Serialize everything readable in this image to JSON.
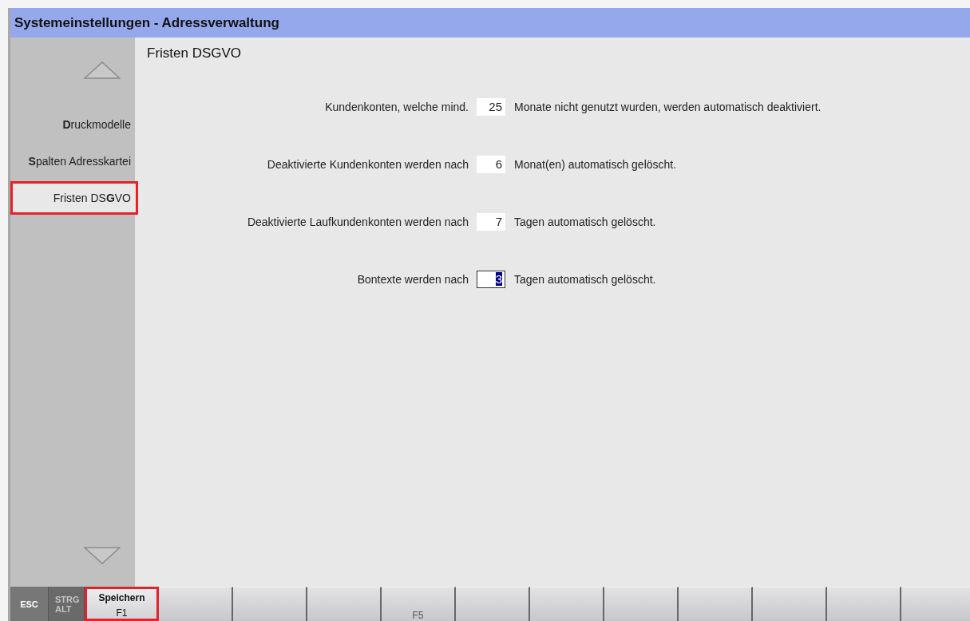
{
  "window": {
    "title": "Systemeinstellungen - Adressverwaltung"
  },
  "sidebar": {
    "items": [
      {
        "label": "**D**ruckmodelle",
        "selected": false
      },
      {
        "label": "**S**palten Adresskartei",
        "selected": false
      },
      {
        "label": "Fristen DS**G**VO",
        "selected": true
      }
    ]
  },
  "panel": {
    "title": "Fristen DSGVO",
    "rows": [
      {
        "label": "Kundenkonten, welche mind.",
        "value": "25",
        "suffix": "Monate nicht genutzt wurden, werden automatisch deaktiviert.",
        "focused": false
      },
      {
        "label": "Deaktivierte Kundenkonten werden nach",
        "value": "6",
        "suffix": "Monat(en) automatisch gelöscht.",
        "focused": false
      },
      {
        "label": "Deaktivierte Laufkundenkonten werden nach",
        "value": "7",
        "suffix": "Tagen automatisch gelöscht.",
        "focused": false
      },
      {
        "label": "Bontexte werden nach",
        "value": "3",
        "suffix": "Tagen automatisch gelöscht.",
        "focused": true
      }
    ]
  },
  "function_keys": [
    {
      "kind": "modifier",
      "lines": [
        "ESC"
      ],
      "disabled": false
    },
    {
      "kind": "modifier",
      "lines": [
        "STRG",
        "ALT"
      ],
      "disabled": true
    },
    {
      "kind": "fkey",
      "label": "Speichern",
      "key": "F1",
      "selected": true
    },
    {
      "kind": "fkey",
      "selected": false
    },
    {
      "kind": "fkey",
      "selected": false
    },
    {
      "kind": "fkey",
      "selected": false
    },
    {
      "kind": "fkey",
      "key": "F5",
      "selected": false
    },
    {
      "kind": "fkey",
      "selected": false
    },
    {
      "kind": "fkey",
      "selected": false
    },
    {
      "kind": "fkey",
      "selected": false
    },
    {
      "kind": "fkey",
      "selected": false
    },
    {
      "kind": "fkey",
      "selected": false
    },
    {
      "kind": "fkey",
      "selected": false
    },
    {
      "kind": "fkey",
      "selected": false
    }
  ]
}
